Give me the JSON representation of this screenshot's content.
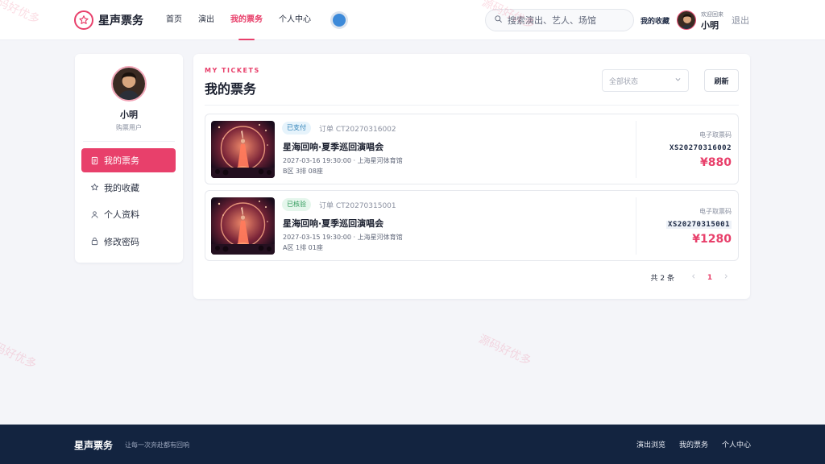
{
  "brand": {
    "name": "星声票务",
    "accent": "#e8406b"
  },
  "nav": {
    "items": [
      {
        "label": "首页",
        "active": false
      },
      {
        "label": "演出",
        "active": false
      },
      {
        "label": "我的票务",
        "active": true
      },
      {
        "label": "个人中心",
        "active": false
      }
    ]
  },
  "search": {
    "placeholder": "搜索演出、艺人、场馆"
  },
  "header_user": {
    "favorites_label": "我的收藏",
    "welcome": "欢迎回来",
    "name": "小明",
    "logout": "退出"
  },
  "sidebar": {
    "name": "小明",
    "role": "购票用户",
    "items": [
      {
        "label": "我的票务",
        "icon": "ticket-icon"
      },
      {
        "label": "我的收藏",
        "icon": "star-icon"
      },
      {
        "label": "个人资料",
        "icon": "user-icon"
      },
      {
        "label": "修改密码",
        "icon": "lock-icon"
      }
    ]
  },
  "main": {
    "eyebrow": "MY TICKETS",
    "title": "我的票务",
    "status_filter": {
      "selected": "全部状态"
    },
    "refresh_label": "刷新"
  },
  "tickets": [
    {
      "status": "已支付",
      "order": "订单 CT20270316002",
      "title": "星海回响·夏季巡回演唱会",
      "time_venue": "2027-03-16 19:30:00 · 上海星河体育馆",
      "seat": "B区 3排 08座",
      "code_label": "电子取票码",
      "code": "XS20270316002",
      "price": "¥880"
    },
    {
      "status": "已核验",
      "order": "订单 CT20270315001",
      "title": "星海回响·夏季巡回演唱会",
      "time_venue": "2027-03-15 19:30:00 · 上海星河体育馆",
      "seat": "A区 1排 01座",
      "code_label": "电子取票码",
      "code": "XS20270315001",
      "price": "¥1280"
    }
  ],
  "pagination": {
    "total": "共 2 条",
    "current": "1"
  },
  "watermark": {
    "text": "源码好优多"
  },
  "footer": {
    "logo": "星声票务",
    "slogan": "让每一次奔赴都有回响",
    "links": [
      "演出浏览",
      "我的票务",
      "个人中心"
    ]
  }
}
